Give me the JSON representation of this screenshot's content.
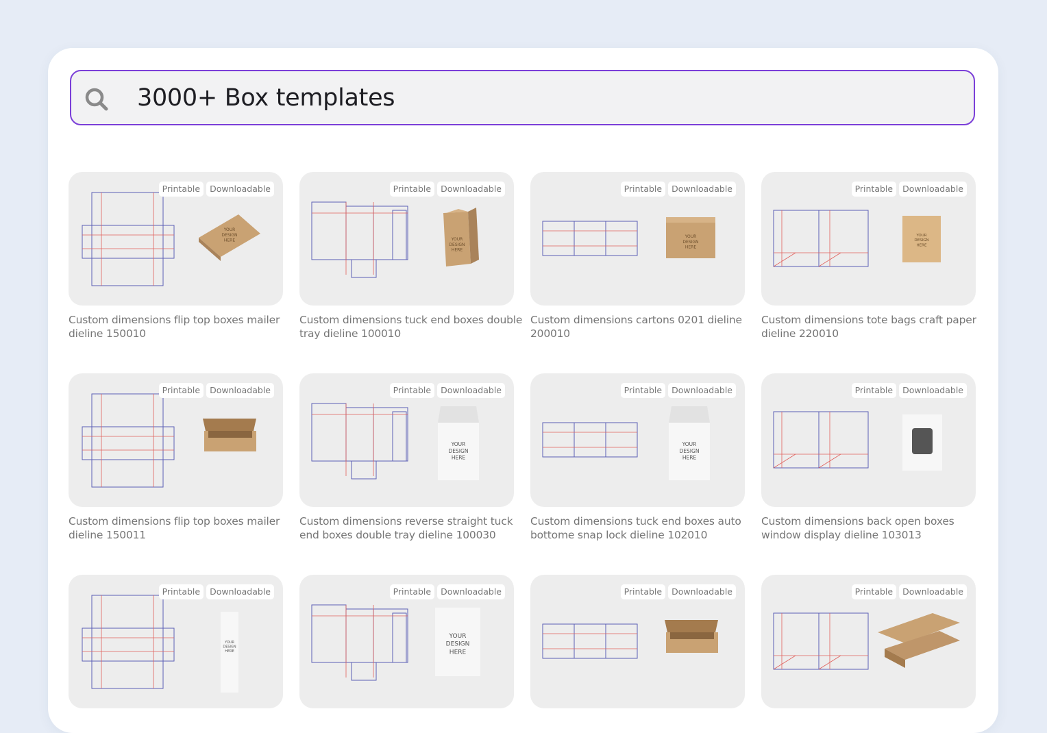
{
  "search": {
    "value": "3000+ Box templates",
    "icon": "search-icon"
  },
  "badges": {
    "printable": "Printable",
    "downloadable": "Downloadable"
  },
  "mockup_text": [
    "YOUR",
    "DESIGN",
    "HERE"
  ],
  "cards": [
    {
      "title": "Custom dimensions flip top boxes mailer dieline 150010",
      "mockup": "kraft-mailer"
    },
    {
      "title": "Custom dimensions tuck end boxes double tray dieline 100010",
      "mockup": "kraft-tuck"
    },
    {
      "title": "Custom dimensions cartons 0201 dieline 200010",
      "mockup": "kraft-carton"
    },
    {
      "title": "Custom dimensions tote bags craft paper dieline 220010",
      "mockup": "kraft-bag"
    },
    {
      "title": "Custom dimensions flip top boxes mailer dieline 150011",
      "mockup": "kraft-open-mailer"
    },
    {
      "title": "Custom dimensions reverse straight tuck end boxes double tray dieline 100030",
      "mockup": "white-tuck"
    },
    {
      "title": "Custom dimensions tuck end boxes auto bottome snap lock dieline 102010",
      "mockup": "white-tuck"
    },
    {
      "title": "Custom dimensions back open boxes window display dieline 103013",
      "mockup": "white-window"
    },
    {
      "title": "",
      "mockup": "white-tall"
    },
    {
      "title": "",
      "mockup": "white-flat"
    },
    {
      "title": "",
      "mockup": "kraft-open-mailer"
    },
    {
      "title": "",
      "mockup": "kraft-lid"
    }
  ],
  "colors": {
    "search_border": "#7b3fd8",
    "background": "#e6ecf6",
    "card_bg": "#ededed",
    "dieline_cut": "#5b5fb5",
    "dieline_fold": "#e0605b",
    "kraft": "#c9a273"
  }
}
